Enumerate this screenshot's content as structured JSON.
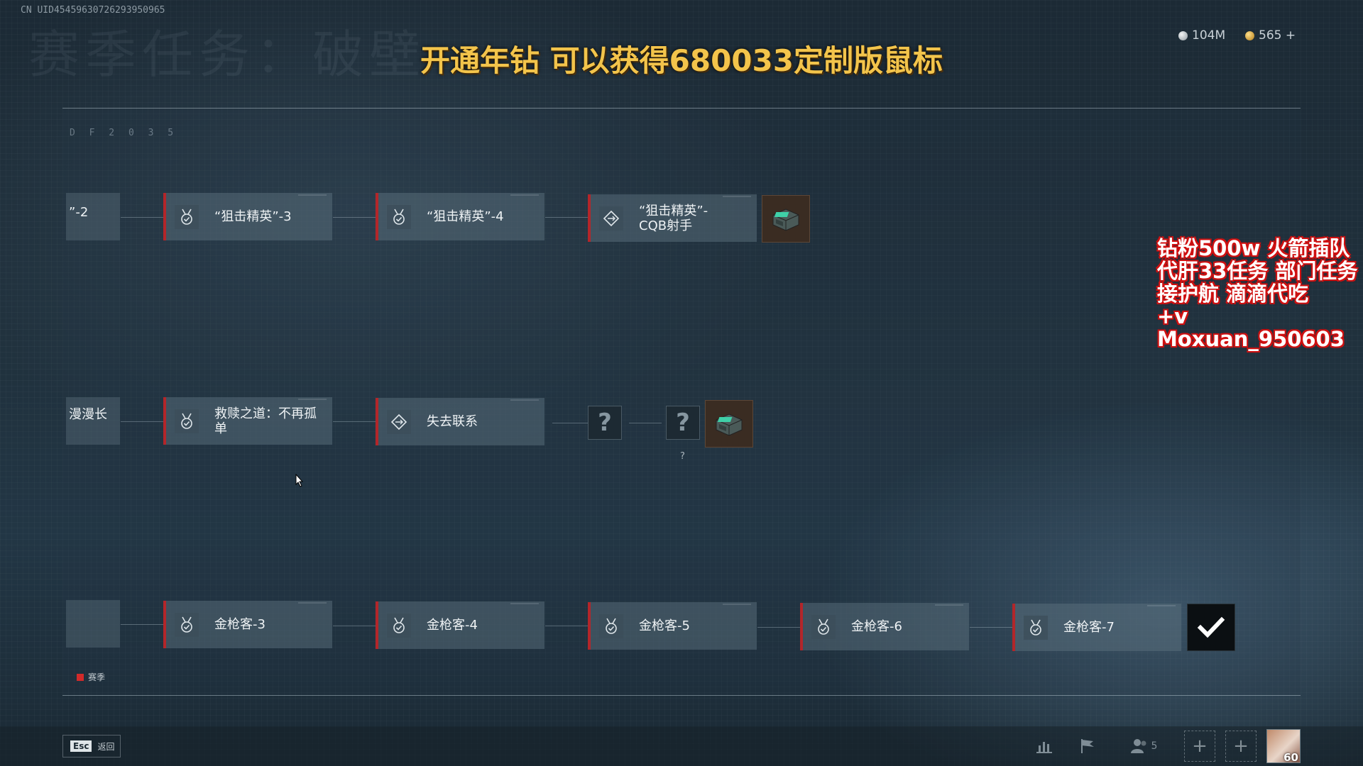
{
  "header": {
    "uid": "CN UID45459630726293950965",
    "faded_title": "赛季任务：破壁",
    "promo_banner": "开通年钻 可以获得680033定制版鼠标"
  },
  "currency": {
    "silver": "104M",
    "gold": "565 +"
  },
  "map": {
    "code": "D F 2 0 3 5"
  },
  "rows": {
    "row1": {
      "edge_label": "”-2",
      "nodes": [
        "“狙击精英”-3",
        "“狙击精英”-4",
        "“狙击精英”-\nCQB射手"
      ]
    },
    "row2": {
      "edge_label": "漫漫长",
      "nodes": [
        "救赎之道：不再孤\n单",
        "失去联系"
      ],
      "unknown": [
        "?",
        "?"
      ],
      "unknown_hint": "?"
    },
    "row3": {
      "nodes": [
        "金枪客-3",
        "金枪客-4",
        "金枪客-5",
        "金枪客-6",
        "金枪客-7"
      ]
    }
  },
  "legend": {
    "label": "赛季",
    "color": "#d22a2a"
  },
  "overlay_ad": {
    "line1": "钻粉500w 火箭插队",
    "line2": "代肝33任务 部门任务",
    "line3": "接护航 滴滴代吃",
    "line4": "+v Moxuan_950603"
  },
  "bottom_bar": {
    "esc_key": "Esc",
    "esc_label": "返回",
    "squad_count": "5",
    "level": "60"
  },
  "icons": [
    "medal-check-icon",
    "diamond-arrows-icon",
    "reward-crate-icon",
    "checkmark-icon",
    "stats-icon",
    "flag-icon",
    "squad-icon",
    "plus-icon"
  ]
}
